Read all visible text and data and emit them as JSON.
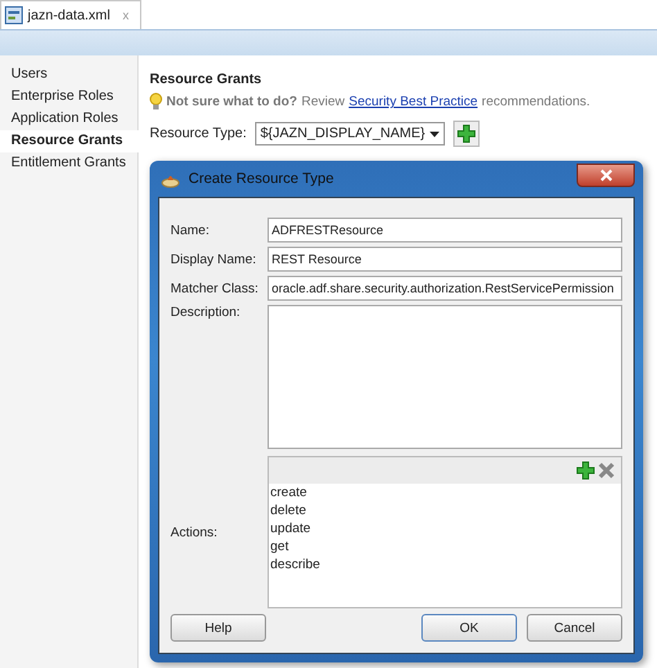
{
  "editor_tab": {
    "label": "jazn-data.xml",
    "close": "x"
  },
  "sidebar": {
    "items": [
      {
        "label": "Users",
        "selected": false
      },
      {
        "label": "Enterprise Roles",
        "selected": false
      },
      {
        "label": "Application Roles",
        "selected": false
      },
      {
        "label": "Resource Grants",
        "selected": true
      },
      {
        "label": "Entitlement Grants",
        "selected": false
      }
    ]
  },
  "main": {
    "title": "Resource Grants",
    "hint": {
      "question": "Not sure what to do?",
      "review": "Review",
      "link": "Security Best Practice",
      "tail": "recommendations."
    },
    "resource_type": {
      "label": "Resource Type:",
      "value": "${JAZN_DISPLAY_NAME}"
    }
  },
  "dialog": {
    "title": "Create Resource Type",
    "fields": [
      {
        "label": "Name:",
        "value": "ADFRESTResource"
      },
      {
        "label": "Display Name:",
        "value": "REST Resource"
      },
      {
        "label": "Matcher Class:",
        "value": "oracle.adf.share.security.authorization.RestServicePermission"
      }
    ],
    "description": {
      "label": "Description:"
    },
    "actions": {
      "label": "Actions:",
      "items": [
        "create",
        "delete",
        "update",
        "get",
        "describe"
      ]
    },
    "buttons": {
      "help": "Help",
      "ok": "OK",
      "cancel": "Cancel"
    }
  }
}
